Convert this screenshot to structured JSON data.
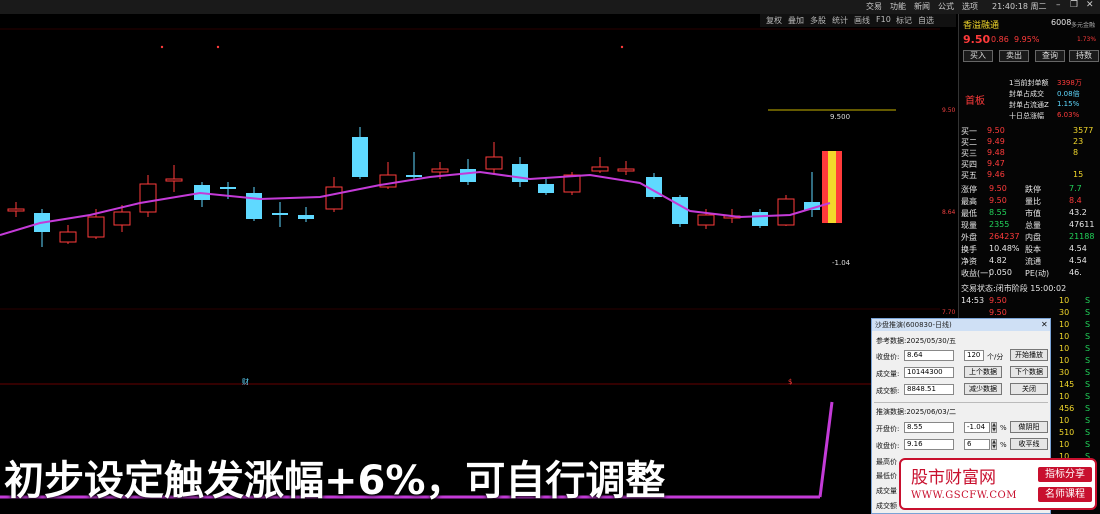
{
  "topbar": {
    "menus": [
      "交易",
      "功能",
      "新闻",
      "公式",
      "选项"
    ],
    "clock": "21:40:18 周二"
  },
  "toolbar": {
    "items": [
      "复权",
      "叠加",
      "多股",
      "统计",
      "画线",
      "F10",
      "标记",
      "自选"
    ]
  },
  "chart": {
    "price_high_label": "9.500",
    "pct_label": "-1.04",
    "bottom_marker": "财",
    "bottom_marker2": "$",
    "axis_labels": [
      "9.50",
      "8.64",
      "7.70"
    ]
  },
  "subtitle": "初步设定触发涨幅+6%，可自行调整",
  "quote": {
    "name": "香溢融通",
    "code": "6008",
    "alert": "多元金融",
    "price": "9.50",
    "change": "0.86",
    "change_pct": "9.95%",
    "side_pct": "1.73%",
    "buttons": [
      "买入",
      "卖出",
      "查询",
      "持数"
    ],
    "board": "首板",
    "seal_rows": [
      {
        "label": "1当前封单额",
        "value": "3398万"
      },
      {
        "label": "封单占成交",
        "value": "0.08倍"
      },
      {
        "label": "封单占流通Z",
        "value": "1.15%"
      },
      {
        "label": "十日总涨幅",
        "value": "6.03%"
      }
    ],
    "right_axis": [
      "9.50",
      "8.64",
      "7.70"
    ],
    "bids": [
      {
        "label": "买一",
        "price": "9.50",
        "vol": "3577"
      },
      {
        "label": "买二",
        "price": "9.49",
        "vol": "23"
      },
      {
        "label": "买三",
        "price": "9.48",
        "vol": "8"
      },
      {
        "label": "买四",
        "price": "9.47",
        "vol": ""
      },
      {
        "label": "买五",
        "price": "9.46",
        "vol": "15"
      }
    ],
    "stats": [
      {
        "l1": "涨停",
        "v1": "9.50",
        "l2": "跌停",
        "v2": "7.7"
      },
      {
        "l1": "最高",
        "v1": "9.50",
        "l2": "量比",
        "v2": "8.4"
      },
      {
        "l1": "最低",
        "v1": "8.55",
        "l2": "市值",
        "v2": "43.2"
      },
      {
        "l1": "现量",
        "v1": "2355",
        "l2": "总量",
        "v2": "47611"
      },
      {
        "l1": "外盘",
        "v1": "264237",
        "l2": "内盘",
        "v2": "21188"
      },
      {
        "l1": "换手",
        "v1": "10.48%",
        "l2": "股本",
        "v2": "4.54"
      },
      {
        "l1": "净资",
        "v1": "4.82",
        "l2": "流通",
        "v2": "4.54"
      },
      {
        "l1": "收益(一)",
        "v1": "0.050",
        "l2": "PE(动)",
        "v2": "46."
      }
    ],
    "trade_status": "交易状态:闭市阶段 15:00:02",
    "ticks": [
      {
        "time": "14:53",
        "price": "9.50",
        "vol": "10",
        "flag": "S"
      },
      {
        "time": "",
        "price": "9.50",
        "vol": "30",
        "flag": "S"
      },
      {
        "time": "",
        "price": "",
        "vol": "10",
        "flag": "S"
      },
      {
        "time": "",
        "price": "",
        "vol": "10",
        "flag": "S"
      },
      {
        "time": "",
        "price": "",
        "vol": "10",
        "flag": "S"
      },
      {
        "time": "",
        "price": "",
        "vol": "10",
        "flag": "S"
      },
      {
        "time": "",
        "price": "",
        "vol": "30",
        "flag": "S"
      },
      {
        "time": "",
        "price": "",
        "vol": "145",
        "flag": "S"
      },
      {
        "time": "",
        "price": "",
        "vol": "10",
        "flag": "S"
      },
      {
        "time": "",
        "price": "",
        "vol": "456",
        "flag": "S"
      },
      {
        "time": "",
        "price": "",
        "vol": "10",
        "flag": "S"
      },
      {
        "time": "",
        "price": "",
        "vol": "510",
        "flag": "S"
      },
      {
        "time": "",
        "price": "",
        "vol": "10",
        "flag": "S"
      },
      {
        "time": "",
        "price": "",
        "vol": "10",
        "flag": "S"
      },
      {
        "time": "",
        "price": "",
        "vol": "10",
        "flag": "S"
      },
      {
        "time": "",
        "price": "",
        "vol": "10",
        "flag": "S"
      }
    ]
  },
  "dialog": {
    "title": "沙盘推演(600830-日线)",
    "ref_header": "参考数据:2025/05/30/五",
    "close_label": "收盘价:",
    "close_value": "8.64",
    "vol_label": "成交量:",
    "vol_value": "10144300",
    "amt_label": "成交额:",
    "amt_value": "8848.51",
    "speed_value": "120",
    "speed_unit": "个/分",
    "btn_play": "开始播放",
    "btn_prev": "上个数据",
    "btn_next": "下个数据",
    "btn_reduce": "减少数据",
    "btn_close": "关闭",
    "sim_header": "推演数据:2025/06/03/二",
    "open_label": "开盘价:",
    "open_value": "8.55",
    "open_pct": "-1.04",
    "sim_close_label": "收盘价:",
    "sim_close_value": "9.16",
    "sim_close_pct": "6",
    "pct_sign": "%",
    "btn_yinyang": "做阴阳",
    "btn_flat": "收平线",
    "high_label": "最高价",
    "low_label": "最低价",
    "vol2_label": "成交量",
    "amt2_label": "成交额"
  },
  "watermark": {
    "title": "股市财富网",
    "url": "WWW.GSCFW.COM",
    "tag1": "指标分享",
    "tag2": "名师课程"
  },
  "colors": {
    "up": "#ff3b3b",
    "down": "#22d35a",
    "candle_down_fill": "#5fd9ff",
    "ma_line": "#c43bd8",
    "limit_bar": "#f2d82b",
    "brand": "#c8102e"
  }
}
